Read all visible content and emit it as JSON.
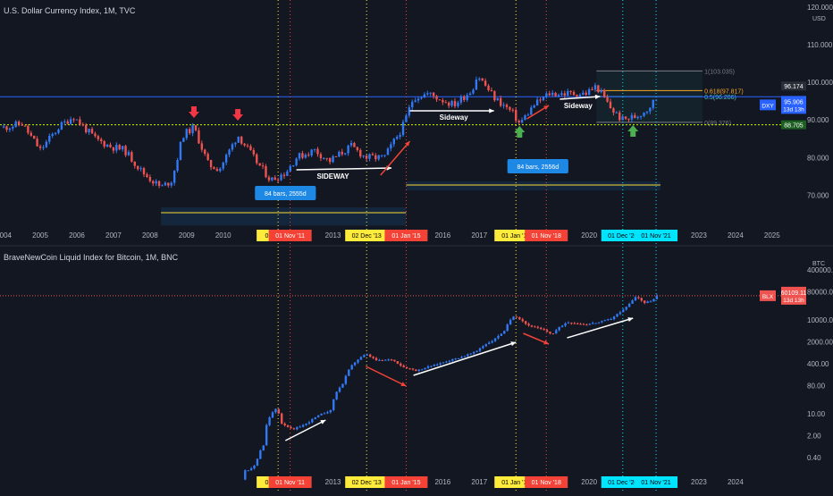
{
  "chart_data": [
    {
      "type": "candlestick",
      "title": "U.S. Dollar Currency Index, 1M, TVC",
      "y_scale": "linear",
      "ylim": [
        62,
        120
      ],
      "y_ticks": [
        "120.000",
        "110.000",
        "100.000",
        "90.000",
        "80.000",
        "70.000"
      ],
      "y_unit_label": "USD",
      "x_ticks": [
        "2004",
        "2005",
        "2006",
        "2007",
        "2008",
        "2009",
        "2010",
        "2013",
        "2016",
        "2017",
        "2020",
        "2023",
        "2024",
        "2025"
      ],
      "x_range": [
        2003.9,
        2025.2
      ],
      "series": [
        {
          "name": "DXY",
          "close_approx": [
            [
              2004.0,
              88
            ],
            [
              2004.5,
              89
            ],
            [
              2005.0,
              82
            ],
            [
              2005.5,
              88
            ],
            [
              2005.9,
              91
            ],
            [
              2006.5,
              85
            ],
            [
              2006.9,
              83
            ],
            [
              2007.3,
              82
            ],
            [
              2007.8,
              76
            ],
            [
              2008.3,
              72
            ],
            [
              2008.6,
              74
            ],
            [
              2008.9,
              86
            ],
            [
              2009.2,
              88
            ],
            [
              2009.6,
              78
            ],
            [
              2009.9,
              77
            ],
            [
              2010.4,
              86
            ],
            [
              2010.9,
              79
            ],
            [
              2011.3,
              74
            ],
            [
              2011.7,
              76
            ],
            [
              2012.0,
              80
            ],
            [
              2012.5,
              82
            ],
            [
              2012.9,
              79
            ],
            [
              2013.5,
              83
            ],
            [
              2013.9,
              80
            ],
            [
              2014.4,
              80
            ],
            [
              2014.9,
              88
            ],
            [
              2015.2,
              96
            ],
            [
              2015.6,
              97
            ],
            [
              2016.3,
              94
            ],
            [
              2016.8,
              98
            ],
            [
              2016.95,
              102
            ],
            [
              2017.4,
              96
            ],
            [
              2017.9,
              92
            ],
            [
              2018.1,
              89
            ],
            [
              2018.5,
              94
            ],
            [
              2018.9,
              97
            ],
            [
              2019.5,
              97
            ],
            [
              2019.9,
              97
            ],
            [
              2020.2,
              99
            ],
            [
              2020.6,
              93
            ],
            [
              2020.9,
              90
            ],
            [
              2021.3,
              91
            ],
            [
              2021.6,
              93
            ],
            [
              2021.85,
              95.9
            ]
          ]
        }
      ],
      "price_label": {
        "symbol": "DXY",
        "value": "95.906",
        "countdown": "13d 13h",
        "color": "#2962ff"
      },
      "level_tags": [
        {
          "text": "96.174",
          "color": "#2a2e39"
        },
        {
          "text": "88.705",
          "color": "#1b5e20"
        }
      ],
      "fib_levels": [
        {
          "text": "1(103.035)",
          "value": 103.035,
          "color": "#787b86"
        },
        {
          "text": "0.618(97.817)",
          "value": 97.817,
          "color": "#f9a825"
        },
        {
          "text": "0.5(96.206)",
          "value": 96.206,
          "color": "#4dd0e1"
        },
        {
          "text": "0(89.376)",
          "value": 89.376,
          "color": "#787b86"
        }
      ],
      "annotations": [
        "SIDEWAY",
        "Sideway",
        "Sideway",
        "84 bars, 2555d",
        "84 bars, 2556d"
      ],
      "date_labels": [
        {
          "text": "01 Jul '11",
          "color": "#ffeb3b",
          "text_color": "#000000"
        },
        {
          "text": "01 Nov '11",
          "color": "#f44336",
          "text_color": "#ffffff"
        },
        {
          "text": "02 Dec '13",
          "color": "#ffeb3b",
          "text_color": "#000000"
        },
        {
          "text": "01 Jan '15",
          "color": "#f44336",
          "text_color": "#ffffff"
        },
        {
          "text": "01 Jan '18",
          "color": "#ffeb3b",
          "text_color": "#000000"
        },
        {
          "text": "01 Nov '18",
          "color": "#f44336",
          "text_color": "#ffffff"
        },
        {
          "text": "01 Dec '20",
          "color": "#00e5ff",
          "text_color": "#000000"
        },
        {
          "text": "01 Nov '21",
          "color": "#00e5ff",
          "text_color": "#000000"
        }
      ]
    },
    {
      "type": "candlestick",
      "title": "BraveNewCoin Liquid Index for Bitcoin, 1M, BNC",
      "y_scale": "log",
      "ylim": [
        0.15,
        1500000
      ],
      "y_ticks": [
        "400000.00",
        "80000.00",
        "10000.00",
        "2000.00",
        "400.00",
        "80.00",
        "10.00",
        "2.00",
        "0.40"
      ],
      "y_unit_label": "BTC",
      "x_ticks": [
        "2013",
        "2016",
        "2017",
        "2020",
        "2023",
        "2024"
      ],
      "x_range": [
        2003.9,
        2025.2
      ],
      "series": [
        {
          "name": "BLX",
          "close_approx": [
            [
              2010.6,
              0.08
            ],
            [
              2010.9,
              0.25
            ],
            [
              2011.1,
              1
            ],
            [
              2011.45,
              15
            ],
            [
              2011.6,
              5
            ],
            [
              2011.9,
              3
            ],
            [
              2012.3,
              5
            ],
            [
              2012.7,
              10
            ],
            [
              2012.95,
              13
            ],
            [
              2013.3,
              100
            ],
            [
              2013.9,
              800
            ],
            [
              2014.2,
              500
            ],
            [
              2014.6,
              550
            ],
            [
              2014.9,
              320
            ],
            [
              2015.3,
              240
            ],
            [
              2015.9,
              400
            ],
            [
              2016.5,
              650
            ],
            [
              2016.9,
              950
            ],
            [
              2017.4,
              2300
            ],
            [
              2017.7,
              4500
            ],
            [
              2017.95,
              14000
            ],
            [
              2018.3,
              7000
            ],
            [
              2018.9,
              4000
            ],
            [
              2019.0,
              3500
            ],
            [
              2019.4,
              8500
            ],
            [
              2019.9,
              7200
            ],
            [
              2020.3,
              8600
            ],
            [
              2020.6,
              11000
            ],
            [
              2020.9,
              19000
            ],
            [
              2021.1,
              33000
            ],
            [
              2021.3,
              58000
            ],
            [
              2021.5,
              35000
            ],
            [
              2021.75,
              43000
            ],
            [
              2021.85,
              60109
            ]
          ]
        }
      ],
      "price_label": {
        "symbol": "BLX",
        "value": "60109.11",
        "countdown": "13d 13h",
        "color": "#ef5350"
      },
      "date_labels": [
        {
          "text": "01 Jul '11",
          "color": "#ffeb3b",
          "text_color": "#000000"
        },
        {
          "text": "01 Nov '11",
          "color": "#f44336",
          "text_color": "#ffffff"
        },
        {
          "text": "02 Dec '13",
          "color": "#ffeb3b",
          "text_color": "#000000"
        },
        {
          "text": "01 Jan '15",
          "color": "#f44336",
          "text_color": "#ffffff"
        },
        {
          "text": "01 Jan '18",
          "color": "#ffeb3b",
          "text_color": "#000000"
        },
        {
          "text": "01 Nov '18",
          "color": "#f44336",
          "text_color": "#ffffff"
        },
        {
          "text": "01 Dec '20",
          "color": "#00e5ff",
          "text_color": "#000000"
        },
        {
          "text": "01 Nov '21",
          "color": "#00e5ff",
          "text_color": "#000000"
        }
      ]
    }
  ],
  "colors": {
    "background": "#131722",
    "up": "#3179f5",
    "down": "#ef5350",
    "axis_text": "#b2b5be",
    "level_line": "#2962ff",
    "support_line": "#c6ff00"
  }
}
